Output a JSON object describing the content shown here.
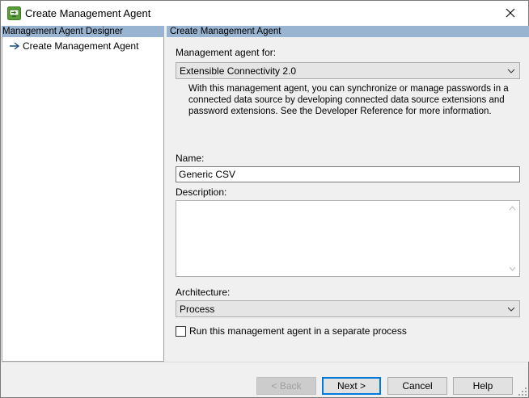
{
  "window": {
    "title": "Create Management Agent",
    "app_icon": "management-agent-icon",
    "close_icon": "close-icon"
  },
  "left_pane": {
    "header": "Management Agent Designer",
    "items": [
      {
        "label": "Create Management Agent",
        "icon": "arrow-right-icon",
        "current": true
      }
    ]
  },
  "right_pane": {
    "header": "Create Management Agent",
    "ma_for_label": "Management agent for:",
    "ma_for_value": "Extensible Connectivity 2.0",
    "description": "With this management agent, you can synchronize or manage passwords in a connected data source by developing connected data source extensions and password extensions. See the Developer Reference for more information.",
    "name_label": "Name:",
    "name_value": "Generic CSV",
    "description_label": "Description:",
    "description_value": "",
    "architecture_label": "Architecture:",
    "architecture_value": "Process",
    "separate_process_label": "Run this management agent in a separate process",
    "separate_process_checked": false
  },
  "buttons": {
    "back": "< Back",
    "next": "Next >",
    "cancel": "Cancel",
    "help": "Help"
  },
  "colors": {
    "header_bg": "#99b4d1",
    "default_button_border": "#0078d7",
    "nav_arrow": "#1f4e79"
  }
}
